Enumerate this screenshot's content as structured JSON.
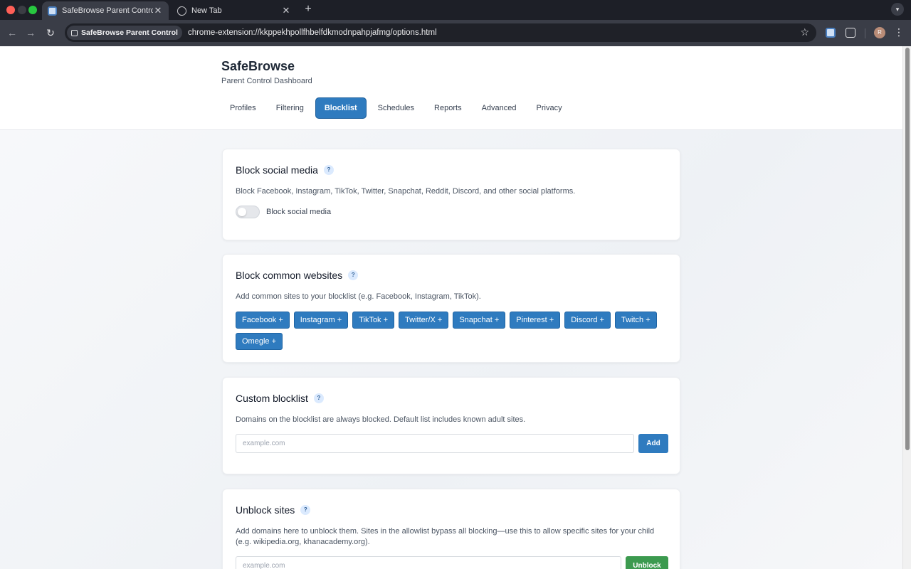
{
  "browser": {
    "tabs": [
      {
        "title": "SafeBrowse Parent Control -",
        "active": true
      },
      {
        "title": "New Tab",
        "active": false
      }
    ],
    "site_chip": "SafeBrowse Parent Control",
    "url": "chrome-extension://kkppekhpollfhbelfdkmodnpahpjafmg/options.html",
    "avatar_letter": "R"
  },
  "header": {
    "title": "SafeBrowse",
    "subtitle": "Parent Control Dashboard",
    "tabs": [
      "Profiles",
      "Filtering",
      "Blocklist",
      "Schedules",
      "Reports",
      "Advanced",
      "Privacy"
    ],
    "active_tab": "Blocklist"
  },
  "social": {
    "title": "Block social media",
    "help": "?",
    "description": "Block Facebook, Instagram, TikTok, Twitter, Snapchat, Reddit, Discord, and other social platforms.",
    "toggle_label": "Block social media",
    "enabled": false
  },
  "common": {
    "title": "Block common websites",
    "help": "?",
    "description": "Add common sites to your blocklist (e.g. Facebook, Instagram, TikTok).",
    "sites": [
      "Facebook +",
      "Instagram +",
      "TikTok +",
      "Twitter/X +",
      "Snapchat +",
      "Pinterest +",
      "Discord +",
      "Twitch +",
      "Omegle +"
    ]
  },
  "custom": {
    "title": "Custom blocklist",
    "help": "?",
    "description": "Domains on the blocklist are always blocked. Default list includes known adult sites.",
    "placeholder": "example.com",
    "button": "Add"
  },
  "unblock": {
    "title": "Unblock sites",
    "help": "?",
    "description_line1": "Add domains here to unblock them. Sites in the allowlist bypass all blocking—use this to allow specific sites for your child",
    "description_line2": "(e.g. wikipedia.org, khanacademy.org).",
    "placeholder": "example.com",
    "button": "Unblock"
  },
  "colors": {
    "primary": "#2f7bbf",
    "success": "#3c9a4f",
    "chrome_dark": "#1d1f27",
    "chrome_toolbar": "#3a3d47"
  }
}
